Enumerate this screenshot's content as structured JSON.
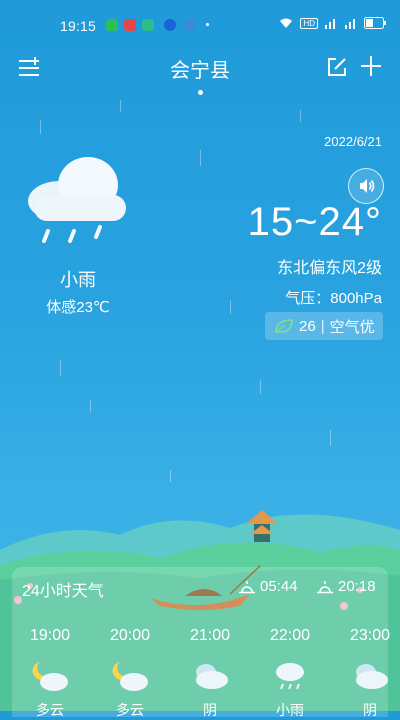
{
  "status_bar": {
    "time": "19:15",
    "battery_icon": "battery-icon",
    "wifi_icon": "wifi-icon",
    "hd_label": "HD"
  },
  "header": {
    "city": "会宁县",
    "menu_icon": "menu-add-icon",
    "edit_icon": "edit-icon",
    "add_icon": "plus-icon"
  },
  "current": {
    "date": "2022/6/21",
    "temp_range": "15~24°",
    "wind": "东北偏东风2级",
    "pressure": "气压：800hPa",
    "aqi_value": "26",
    "aqi_text": "空气优",
    "condition": "小雨",
    "feels_like": "体感23℃"
  },
  "hourly": {
    "title": "24小时天气",
    "sunrise": "05:44",
    "sunset": "20:18",
    "hours": [
      {
        "time": "19:00",
        "condition": "多云"
      },
      {
        "time": "20:00",
        "condition": "多云"
      },
      {
        "time": "21:00",
        "condition": "阴"
      },
      {
        "time": "22:00",
        "condition": "小雨"
      },
      {
        "time": "23:00",
        "condition": "阴"
      }
    ]
  },
  "colors": {
    "sky": "#2aa3e0",
    "hills": "#5ccf9e",
    "aqi_leaf": "#7fe08a"
  }
}
